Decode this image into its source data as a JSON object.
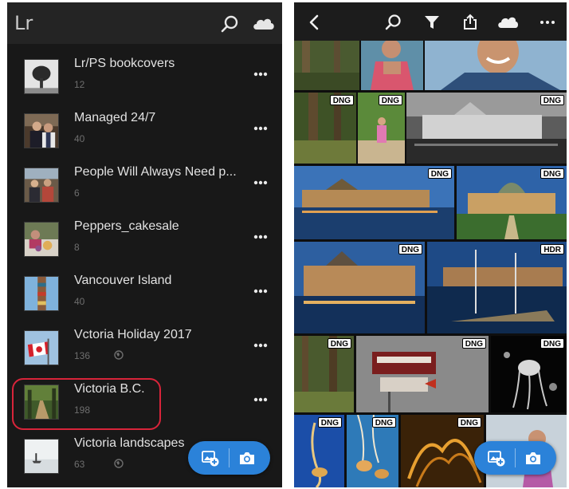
{
  "left": {
    "logo": "Lr",
    "icons": {
      "search": "search-icon",
      "cloud": "cloud-icon"
    },
    "albums": [
      {
        "name": "Lr/PS bookcovers",
        "count": "12",
        "shared": false
      },
      {
        "name": "Managed 24/7",
        "count": "40",
        "shared": false
      },
      {
        "name": "People Will Always Need p...",
        "count": "6",
        "shared": false
      },
      {
        "name": "Peppers_cakesale",
        "count": "8",
        "shared": false
      },
      {
        "name": "Vancouver Island",
        "count": "40",
        "shared": false
      },
      {
        "name": "Vctoria Holiday 2017",
        "count": "136",
        "shared": true
      },
      {
        "name": "Victoria B.C.",
        "count": "198",
        "shared": false
      },
      {
        "name": "Victoria landscapes",
        "count": "63",
        "shared": true
      }
    ],
    "highlighted_album": "Victoria B.C."
  },
  "right": {
    "icons": [
      "back-icon",
      "search-icon",
      "filter-icon",
      "share-icon",
      "cloud-icon",
      "more-icon"
    ],
    "badges": {
      "p4": "DNG",
      "p5": "DNG",
      "p6": "DNG",
      "p7": "DNG",
      "p8": "DNG",
      "p9": "DNG",
      "p10": "HDR",
      "p11": "DNG",
      "p12": "DNG",
      "p13": "DNG",
      "p14": "DNG",
      "p15": "DNG",
      "p16": "DNG"
    }
  },
  "colors": {
    "accent": "#2b82d9",
    "highlight": "#d8243a",
    "panel": "#181818"
  }
}
